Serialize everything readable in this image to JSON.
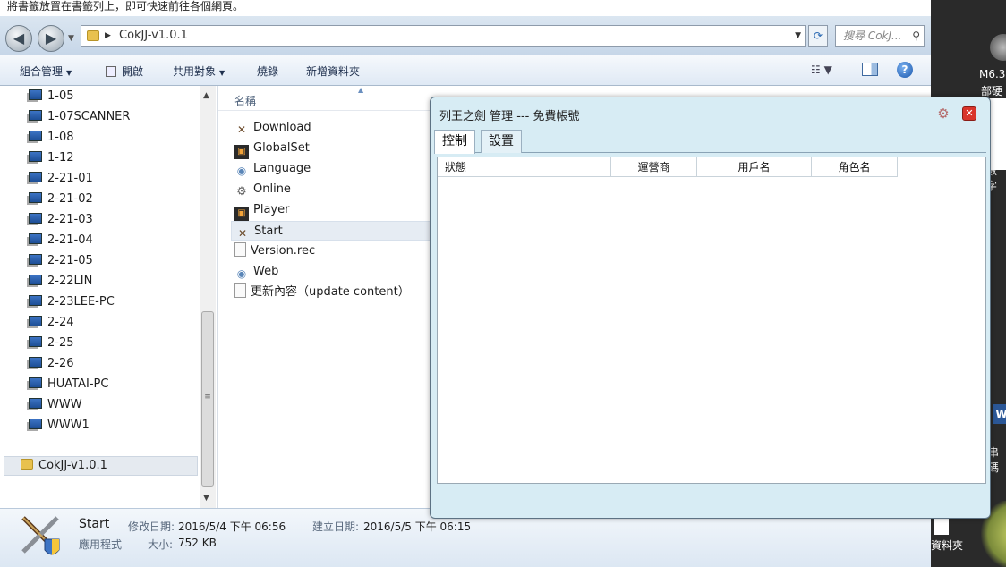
{
  "explorer": {
    "bookmark_hint": "將書籤放置在書籤列上，即可快速前往各個網頁。",
    "address": "CokJJ-v1.0.1",
    "search_placeholder": "搜尋 CokJ...",
    "toolbar": {
      "organize": "組合管理",
      "open": "開啟",
      "share": "共用對象",
      "burn": "燒錄",
      "new_folder": "新增資料夾"
    },
    "nav_items": [
      "1-05",
      "1-07SCANNER",
      "1-08",
      "1-12",
      "2-21-01",
      "2-21-02",
      "2-21-03",
      "2-21-04",
      "2-21-05",
      "2-22LIN",
      "2-23LEE-PC",
      "2-24",
      "2-25",
      "2-26",
      "HUATAI-PC",
      "WWW",
      "WWW1"
    ],
    "nav_folder": "CokJJ-v1.0.1",
    "column_name": "名稱",
    "files": [
      {
        "name": "Download",
        "icon": "swords-icon"
      },
      {
        "name": "GlobalSet",
        "icon": "dat-icon"
      },
      {
        "name": "Language",
        "icon": "gear-globe-icon"
      },
      {
        "name": "Online",
        "icon": "gears-icon"
      },
      {
        "name": "Player",
        "icon": "dat-icon"
      },
      {
        "name": "Start",
        "icon": "swords-icon",
        "selected": true
      },
      {
        "name": "Version.rec",
        "icon": "document-icon"
      },
      {
        "name": "Web",
        "icon": "gear-globe-icon"
      },
      {
        "name": "更新內容（update content）",
        "icon": "document-icon"
      }
    ],
    "details": {
      "name": "Start",
      "type": "應用程式",
      "modified_label": "修改日期:",
      "modified": "2016/5/4 下午 06:56",
      "created_label": "建立日期:",
      "created": "2016/5/5 下午 06:15",
      "size_label": "大小:",
      "size": "752 KB"
    }
  },
  "desktop": {
    "label_1": "M6.3",
    "label_2": "部硬",
    "label_3": "數字",
    "label_4": "串碼",
    "label_5": "資料夾"
  },
  "dialog": {
    "title": "列王之劍  管理 --- 免費帳號",
    "tabs": [
      "控制",
      "設置"
    ],
    "columns": [
      "狀態",
      "運營商",
      "用戶名",
      "角色名"
    ]
  }
}
